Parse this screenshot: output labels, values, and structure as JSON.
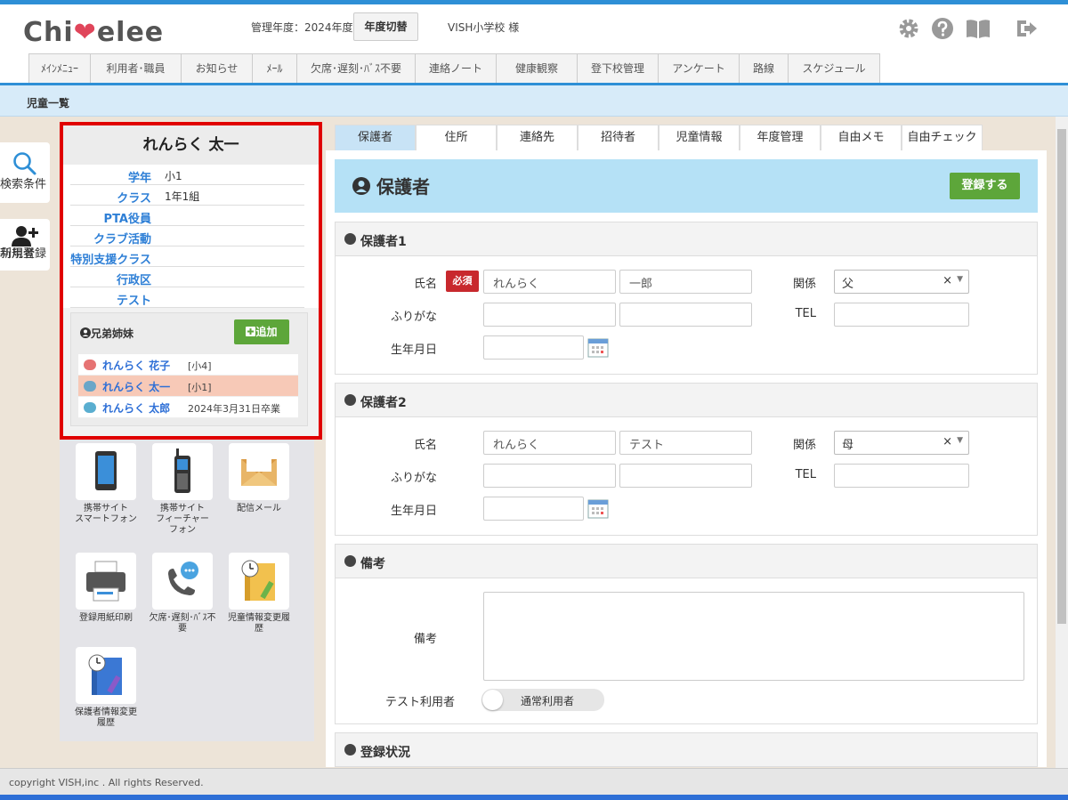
{
  "header": {
    "logo": "Chi❤elee",
    "logo_parts": [
      "Chi",
      "❤",
      "elee"
    ],
    "admin_year": "管理年度：2024年度",
    "year_switch": "年度切替",
    "school": "VISH小学校 様",
    "icons": [
      "gear-icon",
      "help-icon",
      "manual-book-icon",
      "logout-icon"
    ]
  },
  "nav": [
    "ﾒｲﾝﾒﾆｭｰ",
    "利用者･職員",
    "お知らせ",
    "ﾒｰﾙ",
    "欠席･遅刻･ﾊﾞｽ不要",
    "連絡ノート",
    "健康観察",
    "登下校管理",
    "アンケート",
    "路線",
    "スケジュール"
  ],
  "breadcrumb": "児童一覧",
  "side": {
    "search": "検索条件",
    "new_user_1": "利用者",
    "new_user_2": "新規登録"
  },
  "profile": {
    "name": "れんらく 太一",
    "fields": [
      {
        "k": "学年",
        "v": "小1"
      },
      {
        "k": "クラス",
        "v": "1年1組"
      },
      {
        "k": "PTA役員",
        "v": ""
      },
      {
        "k": "クラブ活動",
        "v": ""
      },
      {
        "k": "特別支援クラス",
        "v": ""
      },
      {
        "k": "行政区",
        "v": ""
      },
      {
        "k": "テスト",
        "v": ""
      }
    ],
    "siblings_title": "兄弟姉妹",
    "add_label": "追加",
    "siblings": [
      {
        "name": "れんらく 花子",
        "grade": "[小4]",
        "face": "#e67373"
      },
      {
        "name": "れんらく 太一",
        "grade": "[小1]",
        "face": "#6aa6c8"
      },
      {
        "name": "れんらく 太郎",
        "grade": "2024年3月31日卒業",
        "face": "#5aaed0"
      }
    ]
  },
  "tiles": [
    {
      "l1": "携帯サイト",
      "l2": "スマートフォン",
      "l3": "",
      "icon": "smartphone-icon"
    },
    {
      "l1": "携帯サイト",
      "l2": "フィーチャー",
      "l3": "フォン",
      "icon": "feature-phone-icon"
    },
    {
      "l1": "配信メール",
      "l2": "",
      "l3": "",
      "icon": "mail-icon"
    },
    {
      "l1": "登録用紙印刷",
      "l2": "",
      "l3": "",
      "icon": "printer-icon"
    },
    {
      "l1": "欠席･遅刻･ﾊﾞｽ不",
      "l2": "要",
      "l3": "",
      "icon": "phone-call-icon"
    },
    {
      "l1": "児童情報変更履",
      "l2": "歴",
      "l3": "",
      "icon": "notebook-history-icon"
    },
    {
      "l1": "保護者情報変更",
      "l2": "履歴",
      "l3": "",
      "icon": "notebook-edit-icon"
    }
  ],
  "tabs": [
    "保護者",
    "住所",
    "連絡先",
    "招待者",
    "児童情報",
    "年度管理",
    "自由メモ",
    "自由チェック"
  ],
  "main": {
    "title": "保護者",
    "register": "登録する",
    "guardian1": {
      "title": "保護者1",
      "name_label": "氏名",
      "required": "必須",
      "last": "れんらく",
      "first": "一郎",
      "relation_label": "関係",
      "relation": "父",
      "kana_label": "ふりがな",
      "tel_label": "TEL",
      "birth_label": "生年月日"
    },
    "guardian2": {
      "title": "保護者2",
      "name_label": "氏名",
      "last": "れんらく",
      "first": "テスト",
      "relation_label": "関係",
      "relation": "母",
      "kana_label": "ふりがな",
      "tel_label": "TEL",
      "birth_label": "生年月日"
    },
    "remarks": {
      "title": "備考",
      "label": "備考",
      "test_label": "テスト利用者",
      "toggle": "通常利用者"
    },
    "status": {
      "title": "登録状況"
    }
  },
  "footer": "copyright VISH,inc . All rights Reserved.",
  "colors": {
    "accent": "#2e8fd6",
    "green": "#5da63a",
    "red_box": "#e00000",
    "link": "#2e7fd6"
  }
}
